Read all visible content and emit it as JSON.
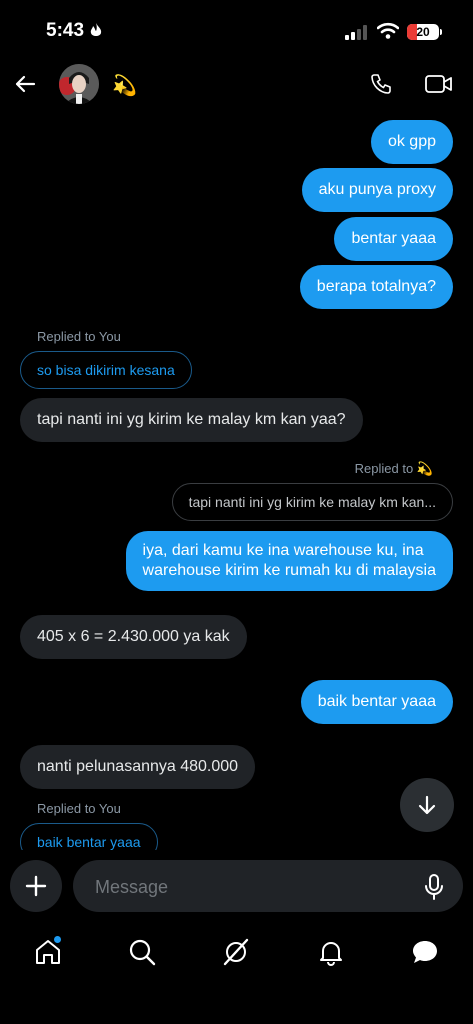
{
  "status_bar": {
    "time": "5:43",
    "battery": "20"
  },
  "header": {
    "contact_emoji": "💫"
  },
  "messages": {
    "m1": "ok gpp",
    "m2": "aku punya proxy",
    "m3": "bentar yaaa",
    "m4": "berapa totalnya?",
    "m5_reply_label": "Replied to You",
    "m5_quote": "so bisa dikirim kesana",
    "m5": "tapi nanti ini yg kirim ke malay km kan yaa?",
    "m6_reply_label": "Replied to 💫",
    "m6_quote": "tapi nanti ini yg kirim ke malay km kan...",
    "m6_line1": "iya, dari kamu ke ina warehouse ku, ina",
    "m6_line2": "warehouse kirim ke rumah ku di malaysia",
    "m7": "405 x 6 = 2.430.000 ya kak",
    "m8": "baik bentar yaaa",
    "m9": "nanti pelunasannya 480.000",
    "m10_reply_label": "Replied to You",
    "m10_quote": "baik bentar yaaa"
  },
  "composer": {
    "placeholder": "Message"
  },
  "colors": {
    "accent": "#1d9bf0",
    "incoming": "#202327",
    "background": "#000000"
  },
  "icons": {
    "back": "arrow-left-icon",
    "call": "phone-icon",
    "video": "video-camera-icon",
    "add": "plus-icon",
    "mic": "microphone-icon",
    "scroll": "arrow-down-icon",
    "nav": [
      "home-icon",
      "search-icon",
      "grok-icon",
      "bell-icon",
      "messages-icon"
    ]
  },
  "nav": {
    "home_has_badge": true
  }
}
